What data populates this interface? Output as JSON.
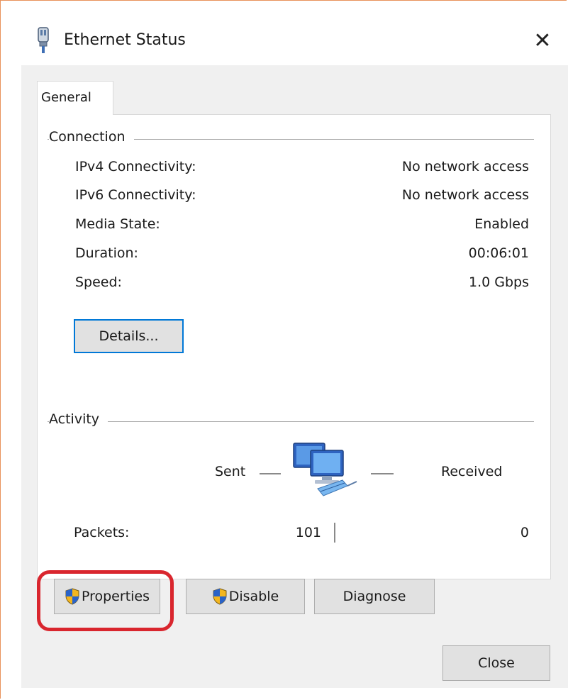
{
  "window": {
    "title": "Ethernet Status",
    "close_glyph": "✕"
  },
  "tabs": [
    {
      "label": "General",
      "active": true
    }
  ],
  "connection": {
    "heading": "Connection",
    "rows": [
      {
        "label": "IPv4 Connectivity:",
        "value": "No network access"
      },
      {
        "label": "IPv6 Connectivity:",
        "value": "No network access"
      },
      {
        "label": "Media State:",
        "value": "Enabled"
      },
      {
        "label": "Duration:",
        "value": "00:06:01"
      },
      {
        "label": "Speed:",
        "value": "1.0 Gbps"
      }
    ],
    "details_button": "Details..."
  },
  "activity": {
    "heading": "Activity",
    "sent_label": "Sent",
    "received_label": "Received",
    "packets_label": "Packets:",
    "packets_sent": "101",
    "packets_received": "0",
    "icon": "network-computers-icon"
  },
  "buttons": {
    "properties": "Properties",
    "disable": "Disable",
    "diagnose": "Diagnose",
    "close": "Close"
  },
  "icons": {
    "title": "ethernet-adapter-icon",
    "shield": "uac-shield-icon"
  },
  "colors": {
    "highlight": "#d9262e",
    "focus": "#0078d7",
    "dialog_bg": "#f0f0f0",
    "accent_frame": "#e8915a"
  }
}
